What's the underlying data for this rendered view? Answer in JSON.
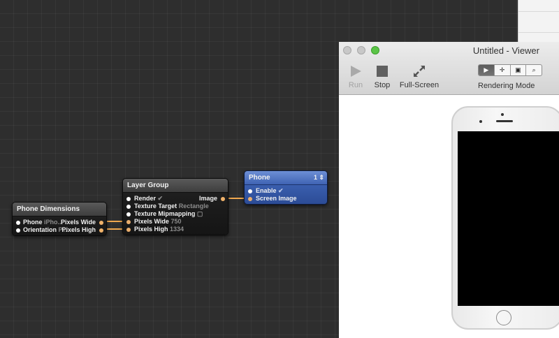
{
  "editor": {
    "nodes": {
      "phone_dimensions": {
        "title": "Phone Dimensions",
        "inputs": [
          {
            "label": "Phone",
            "value": "iPho..."
          },
          {
            "label": "Orientation",
            "value": "P..."
          }
        ],
        "outputs": [
          "Pixels Wide",
          "Pixels High"
        ]
      },
      "layer_group": {
        "title": "Layer Group",
        "inputs": [
          {
            "label": "Render",
            "value": "✔"
          },
          {
            "label": "Texture Target",
            "value": "Rectangle"
          },
          {
            "label": "Texture Mipmapping",
            "value": "▢"
          },
          {
            "label": "Pixels Wide",
            "value": "750"
          },
          {
            "label": "Pixels High",
            "value": "1334"
          }
        ],
        "output": "Image"
      },
      "phone": {
        "title": "Phone",
        "badge": "1 ⇕",
        "inputs": [
          {
            "label": "Enable",
            "value": "✔"
          },
          {
            "label": "Screen Image",
            "value": ""
          }
        ]
      }
    }
  },
  "viewer": {
    "title": "Untitled - Viewer",
    "toolbar": {
      "run_label": "Run",
      "stop_label": "Stop",
      "fullscreen_label": "Full-Screen",
      "rendering_mode_label": "Rendering Mode"
    },
    "rendering_modes": [
      {
        "icon": "play-icon",
        "glyph": "▶",
        "selected": true
      },
      {
        "icon": "move-icon",
        "glyph": "✛",
        "selected": false
      },
      {
        "icon": "inspect-icon",
        "glyph": "▣",
        "selected": false
      },
      {
        "icon": "zoom-icon",
        "glyph": "⌕",
        "selected": false
      }
    ]
  },
  "colors": {
    "wire": "#f0a84f",
    "phone_node": "#3f63b3",
    "traffic_max": "#5bc447"
  }
}
